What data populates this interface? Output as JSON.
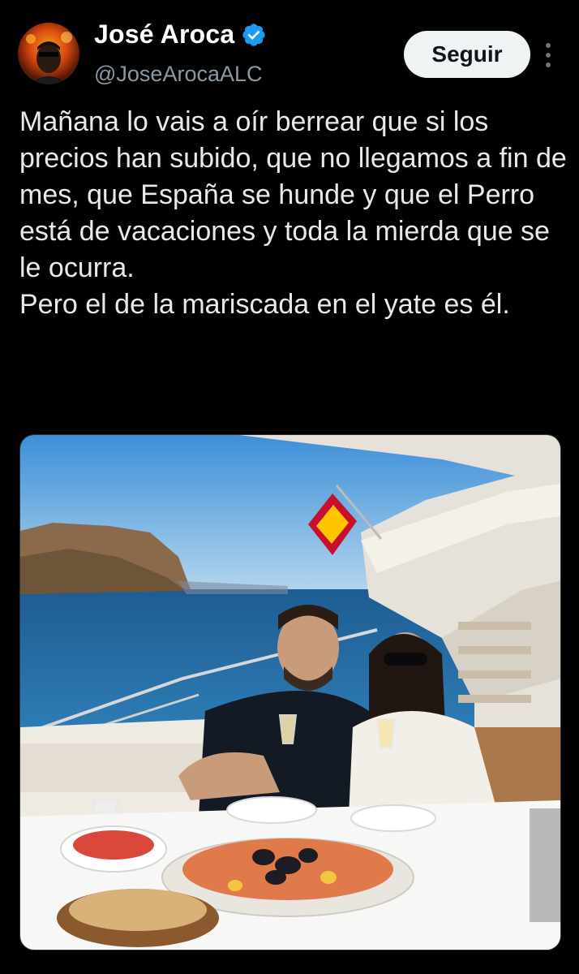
{
  "tweet": {
    "author": {
      "display_name": "José Aroca",
      "handle": "@JoseArocaALC",
      "verified": true,
      "avatar_icon": "avatar-photo"
    },
    "follow_label": "Seguir",
    "more_icon": "more-vertical-icon",
    "text": "Mañana lo vais a oír berrear que si los precios han subido, que no llegamos a fin de mes, que España se hunde y que el Perro está de vacaciones y toda la mierda que se le ocurra.\nPero el de la mariscada en el yate es él.",
    "media": {
      "type": "photo"
    }
  },
  "colors": {
    "background": "#000000",
    "text": "#e7e9ea",
    "secondary_text": "#8b98a5",
    "verified_blue": "#1d9bf0",
    "button_bg": "#eff3f4"
  }
}
